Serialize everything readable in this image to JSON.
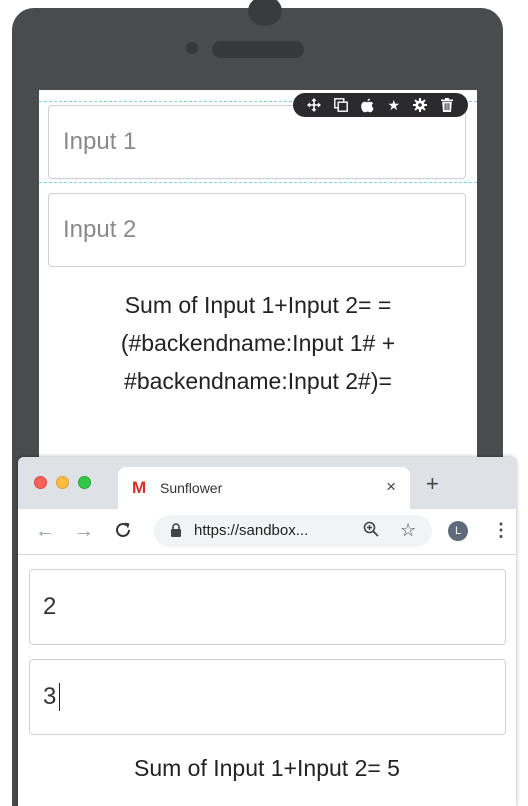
{
  "editor": {
    "input1_placeholder": "Input 1",
    "input2_placeholder": "Input 2",
    "sum_lines": [
      "Sum of Input 1+Input 2= =",
      "(#backendname:Input 1# +",
      "#backendname:Input 2#)="
    ],
    "toolbar_icons": [
      "move-icon",
      "copy-icon",
      "apple-icon",
      "star-icon",
      "gear-icon",
      "trash-icon"
    ]
  },
  "browser": {
    "tab_favicon": "M",
    "tab_title": "Sunflower",
    "tab_close": "×",
    "new_tab": "+",
    "url": "https://sandbox...",
    "profile_initial": "L",
    "input1_value": "2",
    "input2_value": "3",
    "sum_text": "Sum of Input 1+Input 2= 5",
    "colors": {
      "close": "#fc605c",
      "minimize": "#fdbc40",
      "maximize": "#34c84a",
      "favicon": "#d93025"
    }
  }
}
